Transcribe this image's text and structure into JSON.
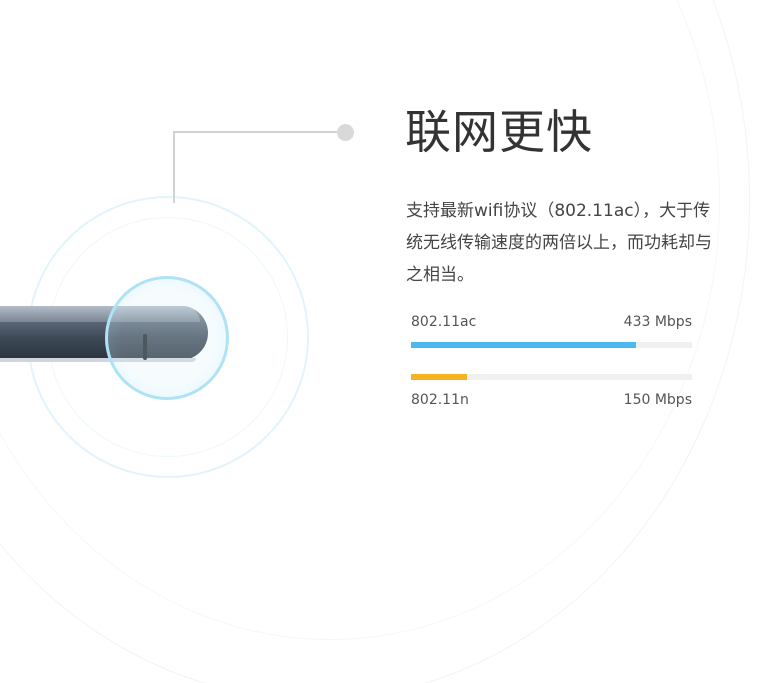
{
  "headline": "联网更快",
  "description": "支持最新wifi协议（802.11ac），大于传统无线传输速度的两倍以上，而功耗却与之相当。",
  "speeds": [
    {
      "protocol": "802.11ac",
      "rate": "433 Mbps",
      "fraction": 0.8,
      "color": "#4cb8f2"
    },
    {
      "protocol": "802.11n",
      "rate": "150 Mbps",
      "fraction": 0.2,
      "color": "#f5b322"
    }
  ]
}
